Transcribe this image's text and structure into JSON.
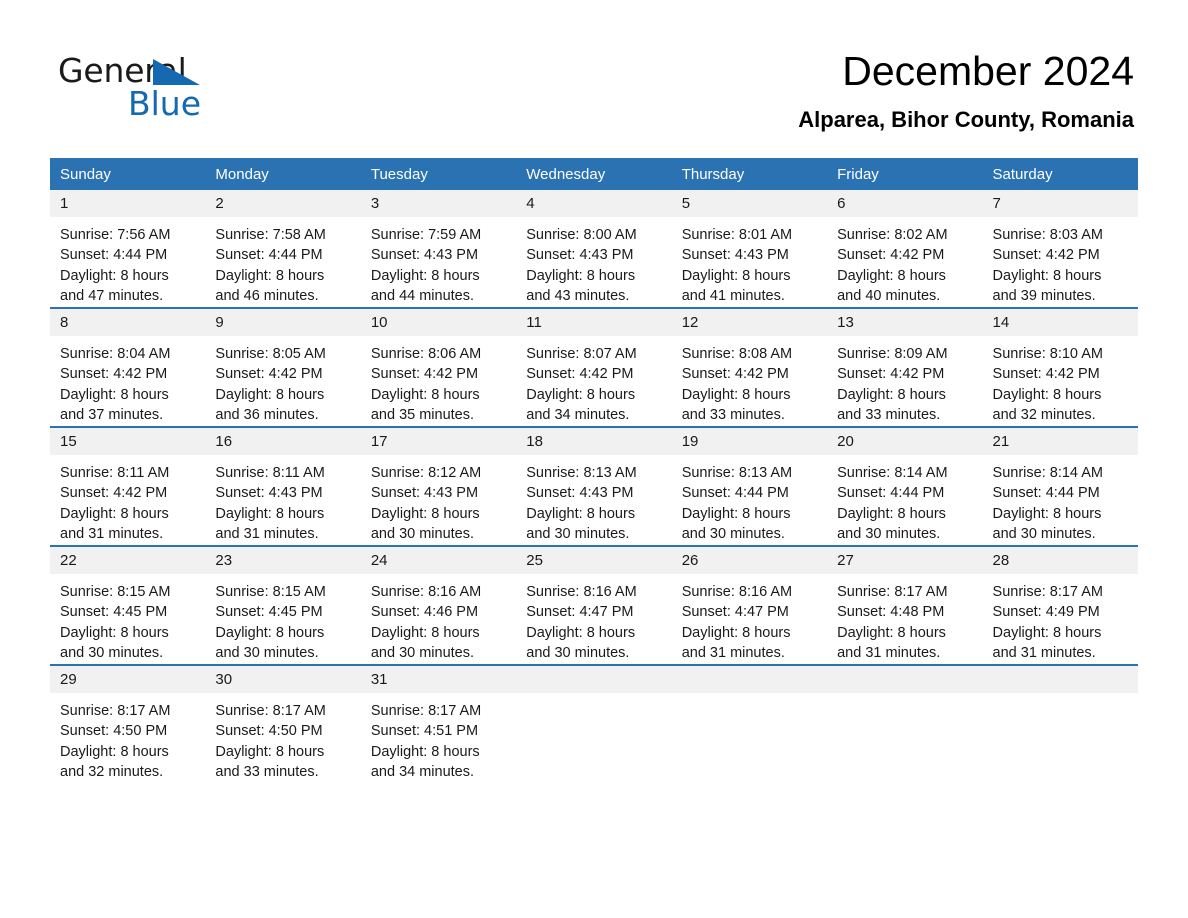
{
  "brand": {
    "name_part1": "General",
    "name_part2": "Blue",
    "triangle_icon": "triangle-icon",
    "accent_color": "#1569b0"
  },
  "header": {
    "title": "December 2024",
    "subtitle": "Alparea, Bihor County, Romania"
  },
  "theme": {
    "header_blue": "#2b72b3",
    "daynum_gray": "#f1f1f1",
    "text": "#1a1a1a"
  },
  "calendar": {
    "weekday_headers": [
      "Sunday",
      "Monday",
      "Tuesday",
      "Wednesday",
      "Thursday",
      "Friday",
      "Saturday"
    ],
    "weeks": [
      [
        {
          "day": "1",
          "sunrise": "Sunrise: 7:56 AM",
          "sunset": "Sunset: 4:44 PM",
          "daylight_line1": "Daylight: 8 hours",
          "daylight_line2": "and 47 minutes."
        },
        {
          "day": "2",
          "sunrise": "Sunrise: 7:58 AM",
          "sunset": "Sunset: 4:44 PM",
          "daylight_line1": "Daylight: 8 hours",
          "daylight_line2": "and 46 minutes."
        },
        {
          "day": "3",
          "sunrise": "Sunrise: 7:59 AM",
          "sunset": "Sunset: 4:43 PM",
          "daylight_line1": "Daylight: 8 hours",
          "daylight_line2": "and 44 minutes."
        },
        {
          "day": "4",
          "sunrise": "Sunrise: 8:00 AM",
          "sunset": "Sunset: 4:43 PM",
          "daylight_line1": "Daylight: 8 hours",
          "daylight_line2": "and 43 minutes."
        },
        {
          "day": "5",
          "sunrise": "Sunrise: 8:01 AM",
          "sunset": "Sunset: 4:43 PM",
          "daylight_line1": "Daylight: 8 hours",
          "daylight_line2": "and 41 minutes."
        },
        {
          "day": "6",
          "sunrise": "Sunrise: 8:02 AM",
          "sunset": "Sunset: 4:42 PM",
          "daylight_line1": "Daylight: 8 hours",
          "daylight_line2": "and 40 minutes."
        },
        {
          "day": "7",
          "sunrise": "Sunrise: 8:03 AM",
          "sunset": "Sunset: 4:42 PM",
          "daylight_line1": "Daylight: 8 hours",
          "daylight_line2": "and 39 minutes."
        }
      ],
      [
        {
          "day": "8",
          "sunrise": "Sunrise: 8:04 AM",
          "sunset": "Sunset: 4:42 PM",
          "daylight_line1": "Daylight: 8 hours",
          "daylight_line2": "and 37 minutes."
        },
        {
          "day": "9",
          "sunrise": "Sunrise: 8:05 AM",
          "sunset": "Sunset: 4:42 PM",
          "daylight_line1": "Daylight: 8 hours",
          "daylight_line2": "and 36 minutes."
        },
        {
          "day": "10",
          "sunrise": "Sunrise: 8:06 AM",
          "sunset": "Sunset: 4:42 PM",
          "daylight_line1": "Daylight: 8 hours",
          "daylight_line2": "and 35 minutes."
        },
        {
          "day": "11",
          "sunrise": "Sunrise: 8:07 AM",
          "sunset": "Sunset: 4:42 PM",
          "daylight_line1": "Daylight: 8 hours",
          "daylight_line2": "and 34 minutes."
        },
        {
          "day": "12",
          "sunrise": "Sunrise: 8:08 AM",
          "sunset": "Sunset: 4:42 PM",
          "daylight_line1": "Daylight: 8 hours",
          "daylight_line2": "and 33 minutes."
        },
        {
          "day": "13",
          "sunrise": "Sunrise: 8:09 AM",
          "sunset": "Sunset: 4:42 PM",
          "daylight_line1": "Daylight: 8 hours",
          "daylight_line2": "and 33 minutes."
        },
        {
          "day": "14",
          "sunrise": "Sunrise: 8:10 AM",
          "sunset": "Sunset: 4:42 PM",
          "daylight_line1": "Daylight: 8 hours",
          "daylight_line2": "and 32 minutes."
        }
      ],
      [
        {
          "day": "15",
          "sunrise": "Sunrise: 8:11 AM",
          "sunset": "Sunset: 4:42 PM",
          "daylight_line1": "Daylight: 8 hours",
          "daylight_line2": "and 31 minutes."
        },
        {
          "day": "16",
          "sunrise": "Sunrise: 8:11 AM",
          "sunset": "Sunset: 4:43 PM",
          "daylight_line1": "Daylight: 8 hours",
          "daylight_line2": "and 31 minutes."
        },
        {
          "day": "17",
          "sunrise": "Sunrise: 8:12 AM",
          "sunset": "Sunset: 4:43 PM",
          "daylight_line1": "Daylight: 8 hours",
          "daylight_line2": "and 30 minutes."
        },
        {
          "day": "18",
          "sunrise": "Sunrise: 8:13 AM",
          "sunset": "Sunset: 4:43 PM",
          "daylight_line1": "Daylight: 8 hours",
          "daylight_line2": "and 30 minutes."
        },
        {
          "day": "19",
          "sunrise": "Sunrise: 8:13 AM",
          "sunset": "Sunset: 4:44 PM",
          "daylight_line1": "Daylight: 8 hours",
          "daylight_line2": "and 30 minutes."
        },
        {
          "day": "20",
          "sunrise": "Sunrise: 8:14 AM",
          "sunset": "Sunset: 4:44 PM",
          "daylight_line1": "Daylight: 8 hours",
          "daylight_line2": "and 30 minutes."
        },
        {
          "day": "21",
          "sunrise": "Sunrise: 8:14 AM",
          "sunset": "Sunset: 4:44 PM",
          "daylight_line1": "Daylight: 8 hours",
          "daylight_line2": "and 30 minutes."
        }
      ],
      [
        {
          "day": "22",
          "sunrise": "Sunrise: 8:15 AM",
          "sunset": "Sunset: 4:45 PM",
          "daylight_line1": "Daylight: 8 hours",
          "daylight_line2": "and 30 minutes."
        },
        {
          "day": "23",
          "sunrise": "Sunrise: 8:15 AM",
          "sunset": "Sunset: 4:45 PM",
          "daylight_line1": "Daylight: 8 hours",
          "daylight_line2": "and 30 minutes."
        },
        {
          "day": "24",
          "sunrise": "Sunrise: 8:16 AM",
          "sunset": "Sunset: 4:46 PM",
          "daylight_line1": "Daylight: 8 hours",
          "daylight_line2": "and 30 minutes."
        },
        {
          "day": "25",
          "sunrise": "Sunrise: 8:16 AM",
          "sunset": "Sunset: 4:47 PM",
          "daylight_line1": "Daylight: 8 hours",
          "daylight_line2": "and 30 minutes."
        },
        {
          "day": "26",
          "sunrise": "Sunrise: 8:16 AM",
          "sunset": "Sunset: 4:47 PM",
          "daylight_line1": "Daylight: 8 hours",
          "daylight_line2": "and 31 minutes."
        },
        {
          "day": "27",
          "sunrise": "Sunrise: 8:17 AM",
          "sunset": "Sunset: 4:48 PM",
          "daylight_line1": "Daylight: 8 hours",
          "daylight_line2": "and 31 minutes."
        },
        {
          "day": "28",
          "sunrise": "Sunrise: 8:17 AM",
          "sunset": "Sunset: 4:49 PM",
          "daylight_line1": "Daylight: 8 hours",
          "daylight_line2": "and 31 minutes."
        }
      ],
      [
        {
          "day": "29",
          "sunrise": "Sunrise: 8:17 AM",
          "sunset": "Sunset: 4:50 PM",
          "daylight_line1": "Daylight: 8 hours",
          "daylight_line2": "and 32 minutes."
        },
        {
          "day": "30",
          "sunrise": "Sunrise: 8:17 AM",
          "sunset": "Sunset: 4:50 PM",
          "daylight_line1": "Daylight: 8 hours",
          "daylight_line2": "and 33 minutes."
        },
        {
          "day": "31",
          "sunrise": "Sunrise: 8:17 AM",
          "sunset": "Sunset: 4:51 PM",
          "daylight_line1": "Daylight: 8 hours",
          "daylight_line2": "and 34 minutes."
        },
        {
          "day": "",
          "sunrise": "",
          "sunset": "",
          "daylight_line1": "",
          "daylight_line2": ""
        },
        {
          "day": "",
          "sunrise": "",
          "sunset": "",
          "daylight_line1": "",
          "daylight_line2": ""
        },
        {
          "day": "",
          "sunrise": "",
          "sunset": "",
          "daylight_line1": "",
          "daylight_line2": ""
        },
        {
          "day": "",
          "sunrise": "",
          "sunset": "",
          "daylight_line1": "",
          "daylight_line2": ""
        }
      ]
    ]
  }
}
